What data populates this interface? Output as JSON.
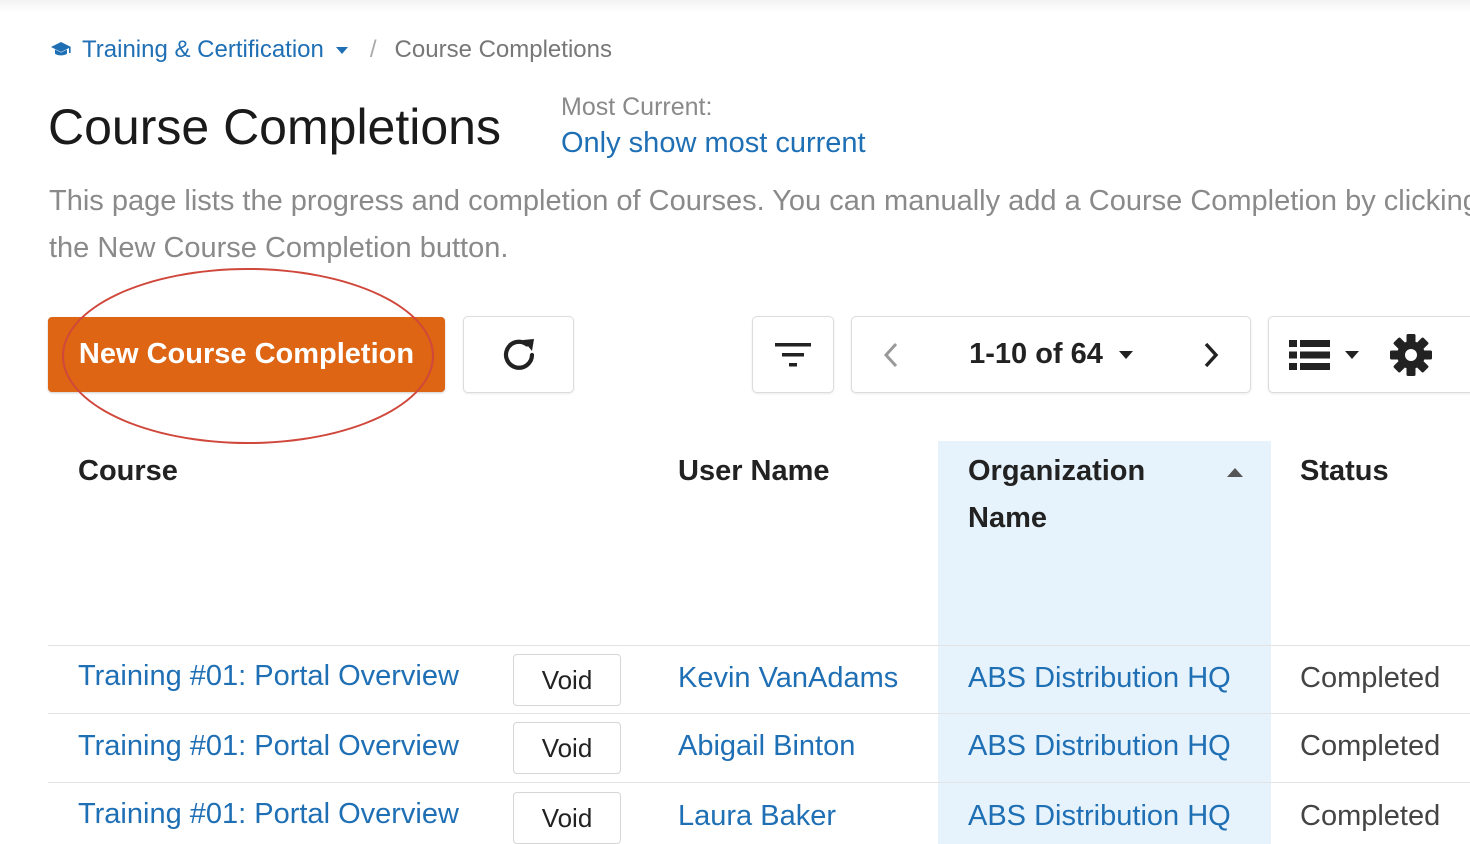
{
  "breadcrumb": {
    "section": "Training & Certification",
    "current": "Course Completions"
  },
  "header": {
    "title": "Course Completions",
    "most_current_label": "Most Current:",
    "most_current_link": "Only show most current"
  },
  "description": "This page lists the progress and completion of Courses. You can manually add a Course Completion by clicking the New Course Completion button.",
  "toolbar": {
    "new_button": "New Course Completion",
    "pagination": "1-10 of 64"
  },
  "table": {
    "headers": {
      "course": "Course",
      "user": "User Name",
      "org": "Organization Name",
      "status": "Status"
    },
    "sorted_column": "Organization Name",
    "sort_direction": "ascending",
    "rows": [
      {
        "course": "Training #01: Portal Overview",
        "action": "Void",
        "user": "Kevin VanAdams",
        "org": "ABS Distribution HQ",
        "status": "Completed"
      },
      {
        "course": "Training #01: Portal Overview",
        "action": "Void",
        "user": "Abigail Binton",
        "org": "ABS Distribution HQ",
        "status": "Completed"
      },
      {
        "course": "Training #01: Portal Overview",
        "action": "Void",
        "user": "Laura Baker",
        "org": "ABS Distribution HQ",
        "status": "Completed"
      }
    ]
  },
  "icons": [
    "graduation-cap-icon",
    "refresh-icon",
    "filter-icon",
    "chevron-left-icon",
    "chevron-right-icon",
    "list-view-icon",
    "gear-icon"
  ],
  "colors": {
    "accent": "#dd6514",
    "link": "#1f6fb5",
    "sorted_column_bg": "#e6f3fc",
    "annotation": "#d0473b"
  }
}
